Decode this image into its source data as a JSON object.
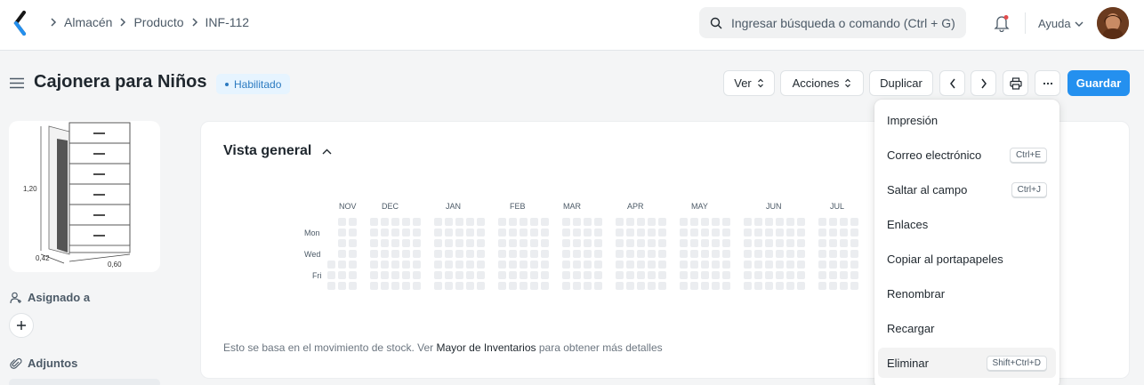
{
  "navbar": {
    "breadcrumbs": [
      "Almacén",
      "Producto",
      "INF-112"
    ],
    "search_placeholder": "Ingresar búsqueda o comando (Ctrl + G)",
    "help_label": "Ayuda"
  },
  "page": {
    "title": "Cajonera para Niños",
    "status_badge": "Habilitado"
  },
  "toolbar": {
    "view_label": "Ver",
    "actions_label": "Acciones",
    "duplicate_label": "Duplicar",
    "save_label": "Guardar"
  },
  "sidebar": {
    "image_dims": {
      "height": "1,20",
      "depth": "0,42",
      "width": "0,60"
    },
    "assigned_label": "Asignado a",
    "attachments_label": "Adjuntos"
  },
  "overview": {
    "title": "Vista general",
    "months": [
      "NOV",
      "DEC",
      "JAN",
      "FEB",
      "MAR",
      "APR",
      "MAY",
      "JUN",
      "JUL"
    ],
    "days": [
      "Mon",
      "Wed",
      "Fri"
    ],
    "note_prefix": "Esto se basa en el movimiento de stock. Ver ",
    "note_link": "Mayor de Inventarios",
    "note_suffix": " para obtener más detalles"
  },
  "menu": {
    "items": [
      {
        "label": "Impresión",
        "shortcut": ""
      },
      {
        "label": "Correo electrónico",
        "shortcut": "Ctrl+E"
      },
      {
        "label": "Saltar al campo",
        "shortcut": "Ctrl+J"
      },
      {
        "label": "Enlaces",
        "shortcut": ""
      },
      {
        "label": "Copiar al portapapeles",
        "shortcut": ""
      },
      {
        "label": "Renombrar",
        "shortcut": ""
      },
      {
        "label": "Recargar",
        "shortcut": ""
      },
      {
        "label": "Eliminar",
        "shortcut": "Shift+Ctrl+D"
      }
    ]
  },
  "colors": {
    "primary": "#2490ef",
    "badge_bg": "#e6f4ff",
    "badge_text": "#2b7ac0",
    "heat_empty": "#ebedf0"
  }
}
